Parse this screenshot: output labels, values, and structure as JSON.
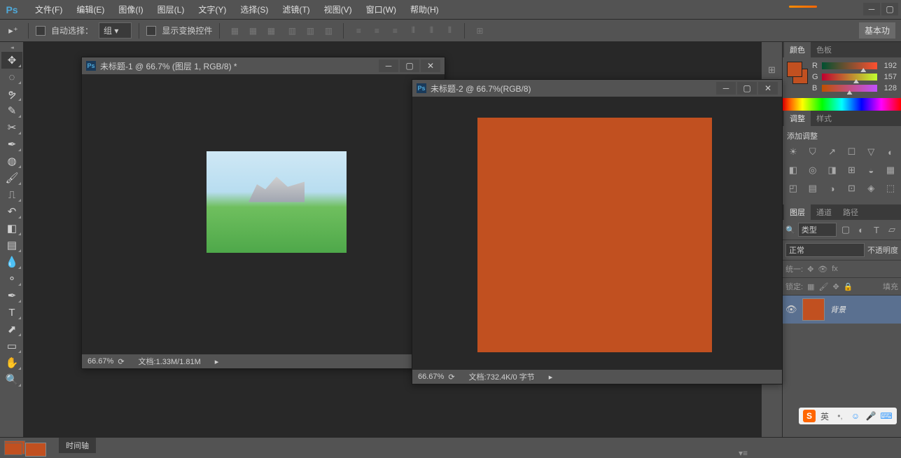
{
  "app": {
    "logo": "Ps"
  },
  "menus": {
    "file": "文件(F)",
    "edit": "编辑(E)",
    "image": "图像(I)",
    "layer": "图层(L)",
    "type": "文字(Y)",
    "select": "选择(S)",
    "filter": "滤镜(T)",
    "view": "视图(V)",
    "window": "窗口(W)",
    "help": "帮助(H)"
  },
  "options": {
    "auto_select_label": "自动选择：",
    "auto_select_target": "组",
    "show_transform_label": "显示变换控件",
    "workspace_label": "基本功"
  },
  "doc1": {
    "title": "未标题-1 @ 66.7% (图层 1, RGB/8) *",
    "zoom": "66.67%",
    "info": "文档:1.33M/1.81M"
  },
  "doc2": {
    "title": "未标题-2 @ 66.7%(RGB/8)",
    "zoom": "66.67%",
    "info": "文档:732.4K/0 字节"
  },
  "color_panel": {
    "tab_color": "颜色",
    "tab_swatches": "色板",
    "r_label": "R",
    "r_value": "192",
    "g_label": "G",
    "g_value": "157",
    "b_label": "B",
    "b_value": "128"
  },
  "adjust_panel": {
    "tab_adjust": "调整",
    "tab_styles": "样式",
    "add_label": "添加调整"
  },
  "layers_panel": {
    "tab_layers": "图层",
    "tab_channels": "通道",
    "tab_paths": "路径",
    "filter_label": "类型",
    "blend_mode": "正常",
    "opacity_label": "不透明度",
    "unify_label": "统一:",
    "lock_label": "锁定:",
    "fill_label": "填充",
    "layer_name": "背景"
  },
  "timeline": {
    "tab": "时间轴"
  },
  "ime": {
    "lang": "英"
  },
  "colors": {
    "orange": "#c15020"
  }
}
